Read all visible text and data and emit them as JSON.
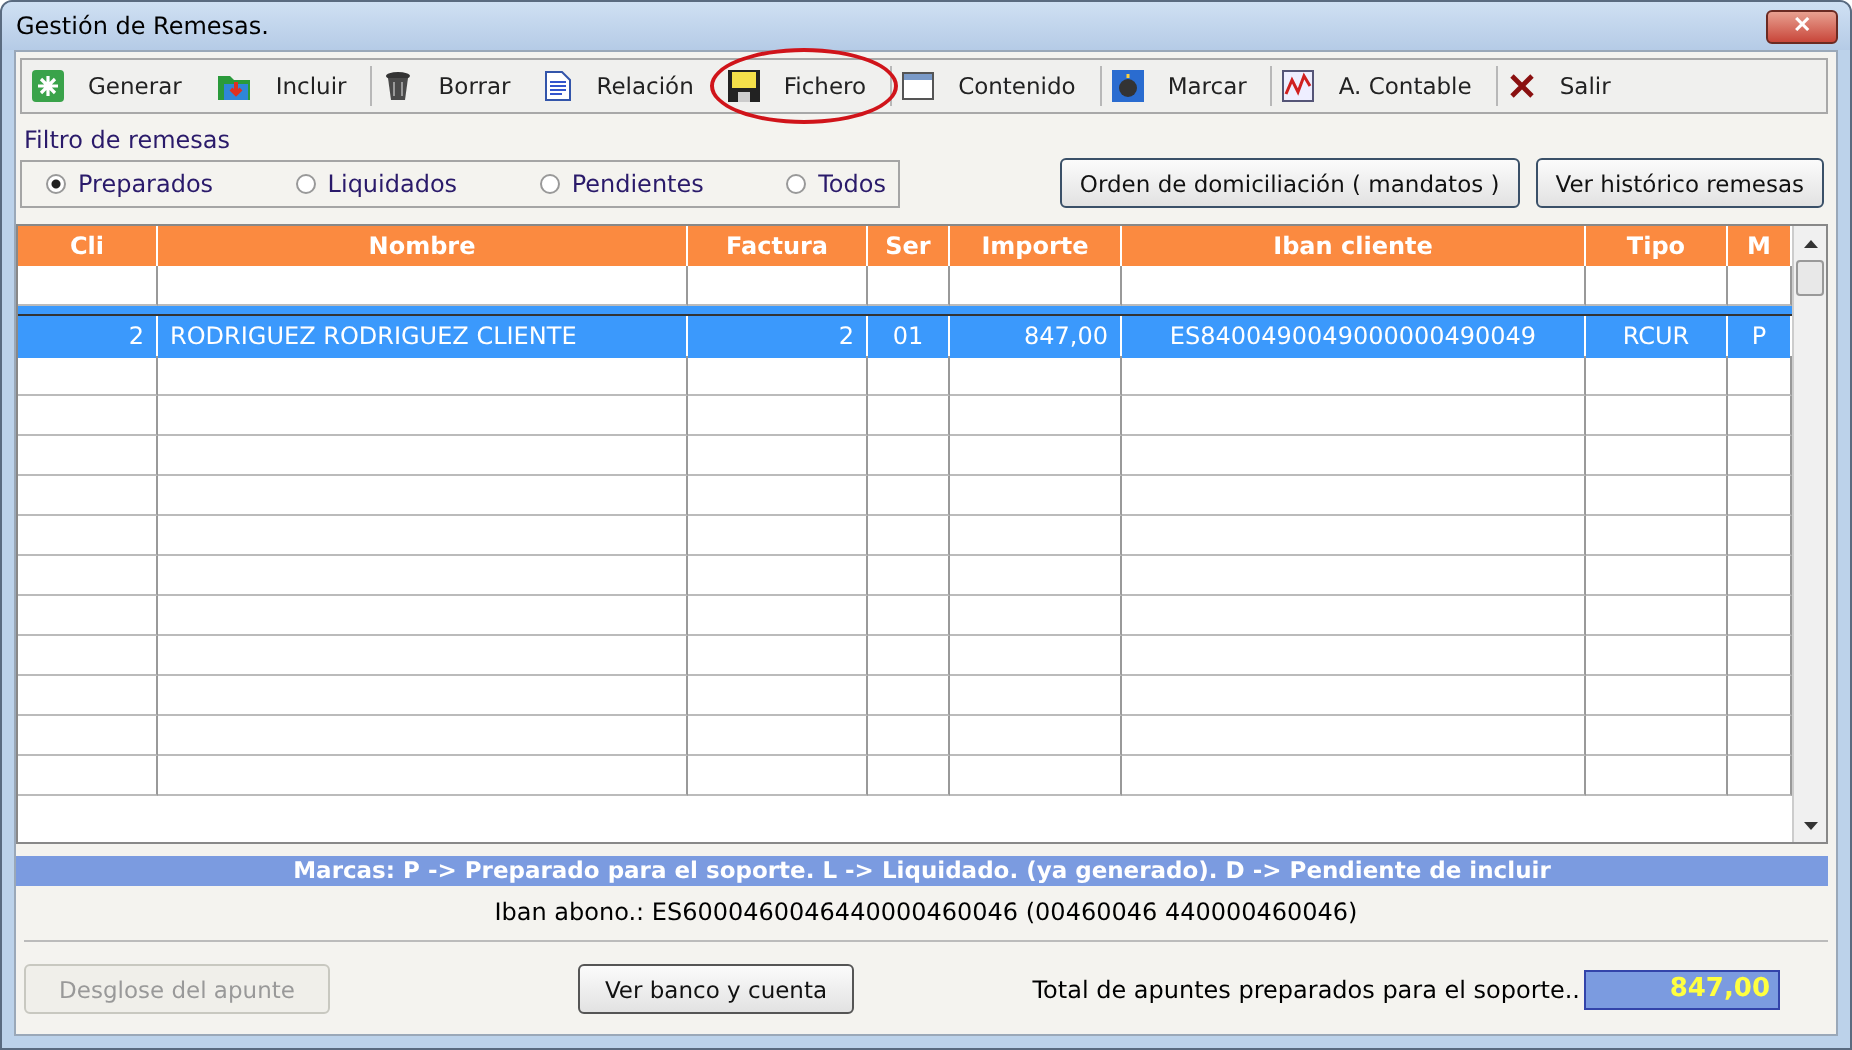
{
  "window": {
    "title": "Gestión de Remesas.",
    "close_label": "✕"
  },
  "toolbar": [
    {
      "label": "Generar",
      "highlighted": false
    },
    {
      "label": "Incluir",
      "highlighted": false
    },
    {
      "label": "Borrar",
      "highlighted": false
    },
    {
      "label": "Relación",
      "highlighted": false
    },
    {
      "label": "Fichero",
      "highlighted": true
    },
    {
      "label": "Contenido",
      "highlighted": false
    },
    {
      "label": "Marcar",
      "highlighted": false
    },
    {
      "label": "A. Contable",
      "highlighted": false
    },
    {
      "label": "Salir",
      "highlighted": false
    }
  ],
  "filter": {
    "title": "Filtro de remesas",
    "options": [
      {
        "label": "Preparados",
        "selected": true
      },
      {
        "label": "Liquidados",
        "selected": false
      },
      {
        "label": "Pendientes",
        "selected": false
      },
      {
        "label": "Todos",
        "selected": false
      }
    ]
  },
  "top_buttons": [
    "Orden de domiciliación ( mandatos )",
    "Ver histórico remesas"
  ],
  "table": {
    "columns": [
      "Cli",
      "Nombre",
      "Factura",
      "Ser",
      "Importe",
      "Iban cliente",
      "Tipo",
      "M"
    ],
    "rows": [
      {
        "cells": [
          "2",
          "RODRIGUEZ RODRIGUEZ CLIENTE",
          "2",
          "01",
          "847,00",
          "ES8400490049000000490049",
          "RCUR",
          "P"
        ],
        "selected": true
      }
    ]
  },
  "legend": "Marcas:  P -> Preparado para el soporte.  L ->  Liquidado. (ya generado).   D -> Pendiente de incluir",
  "iban_abono": "Iban abono.: ES6000460046440000460046 (00460046 440000460046)",
  "bottom": {
    "breakdown_button": {
      "label": "Desglose del apunte",
      "disabled": true
    },
    "bank_button": "Ver banco y cuenta",
    "total_label": "Total de apuntes preparados para el soporte..",
    "total_value": "847,00"
  }
}
